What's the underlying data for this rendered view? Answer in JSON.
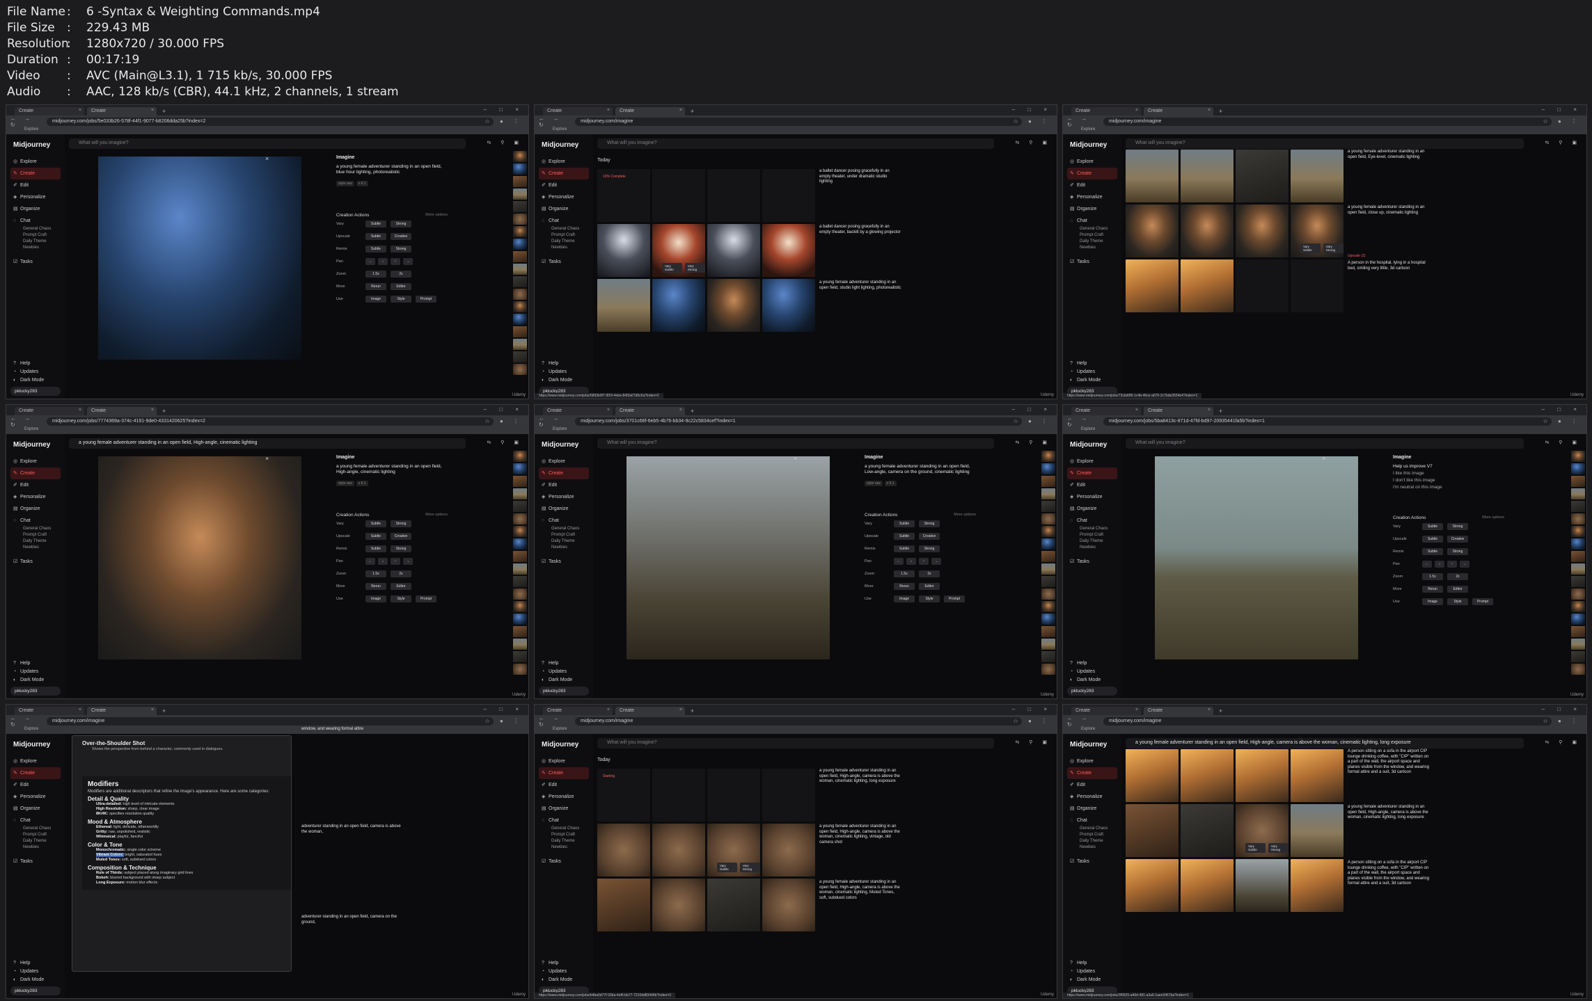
{
  "media_info": [
    {
      "key": "File Name",
      "value": "6 -Syntax & Weighting Commands.mp4"
    },
    {
      "key": "File Size",
      "value": "229.43 MB"
    },
    {
      "key": "Resolution",
      "value": "1280x720 / 30.000 FPS"
    },
    {
      "key": "Duration",
      "value": "00:17:19"
    },
    {
      "key": "Video",
      "value": "AVC (Main@L3.1), 1 715 kb/s, 30.000 FPS"
    },
    {
      "key": "Audio",
      "value": "AAC, 128 kb/s (CBR), 44.1 kHz, 2 channels, 1 stream"
    }
  ],
  "separator": ":",
  "browser": {
    "tab1": "Create",
    "tab2": "Create",
    "tab_close": "×",
    "new_tab": "+",
    "window_controls": "– □ ×",
    "nav_buttons": "← → ↻",
    "addr_icons": "☆ ● ⋮",
    "bookmark": "Explore"
  },
  "sidebar": {
    "logo": "Midjourney",
    "items": [
      {
        "label": "Explore",
        "icon": "◎"
      },
      {
        "label": "Create",
        "icon": "✎"
      },
      {
        "label": "Edit",
        "icon": "✐"
      },
      {
        "label": "Personalize",
        "icon": "◈"
      },
      {
        "label": "Organize",
        "icon": "▤"
      },
      {
        "label": "Chat",
        "icon": "◌"
      }
    ],
    "chat_rooms": [
      "General Chaos",
      "Prompt Craft",
      "Daily Theme",
      "Newbies"
    ],
    "tasks": {
      "label": "Tasks",
      "icon": "☑"
    },
    "bottom": [
      {
        "label": "Help",
        "icon": "?"
      },
      {
        "label": "Updates",
        "icon": "◔"
      },
      {
        "label": "Dark Mode",
        "icon": "◐"
      }
    ],
    "user": "pklucky283"
  },
  "prompt_placeholder": "What will you imagine?",
  "prompt_tools": "⇆ ⚲ ▣",
  "today_label": "Today",
  "watermark": "Udemy",
  "detail": {
    "imagine": "Imagine",
    "creation_actions": "Creation Actions",
    "more_options": "More options",
    "style_raw": "style raw",
    "version": "v 6.1",
    "actions": [
      {
        "label": "Vary",
        "buttons": [
          "Subtle",
          "Strong"
        ]
      },
      {
        "label": "Upscale",
        "buttons": [
          "Subtle",
          "Creative"
        ]
      },
      {
        "label": "Remix",
        "buttons": [
          "Subtle",
          "Strong"
        ]
      },
      {
        "label": "Pan",
        "buttons": [
          "←",
          "↓",
          "↑",
          "→"
        ]
      },
      {
        "label": "Zoom",
        "buttons": [
          "1.5x",
          "2x"
        ]
      },
      {
        "label": "More",
        "buttons": [
          "Rerun",
          "Editor"
        ]
      },
      {
        "label": "Use",
        "buttons": [
          "Image",
          "Style",
          "Prompt"
        ]
      }
    ],
    "feedback_title": "Help us improve V7",
    "feedback_options": [
      "I like this image",
      "I don't like this image",
      "I'm neutral on this image"
    ]
  },
  "vary_tags": [
    "Vary Subtle",
    "Vary Strong"
  ],
  "frames": [
    {
      "url": "midjourney.com/jobs/5e033b26-578f-44f1-9077-b8206dda25b?index=2",
      "view": "detail",
      "prompt": "",
      "desc": "a young female adventurer standing in an open field, blue hour lighting, photorealistic"
    },
    {
      "url": "midjourney.com/imagine",
      "view": "feed",
      "status": "10% Complete",
      "prompts": [
        "a ballet dancer posing gracefully in an empty theater, under dramatic studio lighting",
        "a ballet dancer posing gracefully in an empty theater, backlit by a glowing projector",
        "a young female adventurer standing in an open field, studio light lighting, photorealistic"
      ],
      "statusurl": "https://www.midjourney.com/jobs/5893b0f7-9f24-4ebe-84f3a07d5c6a?index=2"
    },
    {
      "url": "midjourney.com/imagine",
      "view": "feed",
      "prompts": [
        "a young female adventurer standing in an open field, Eye-level, cinematic lighting",
        "a young female adventurer standing in an open field, close up, cinematic lighting",
        "A person in the hospital, lying in a hospital bed, smiling very little, 3d cartoon"
      ],
      "badge": "Upscale (2)",
      "statusurl": "https://www.midjourney.com/jobs/73cbd0f6-1c4b-46ce-a676-2c7bde3554e4?index=1"
    },
    {
      "url": "midjourney.com/jobs/7774369a-374c-4191-9de0-4331420625?index=2",
      "view": "detail",
      "prompt": "a young female adventurer standing in an open field, High-angle, cinematic lighting",
      "desc": "a young female adventurer standing in an open field, High-angle, cinematic lighting",
      "badge": "0/3"
    },
    {
      "url": "midjourney.com/jobs/3701c66f-6eb5-4b76-bb34-9c22c5834cef?index=1",
      "view": "detail",
      "prompt": "",
      "desc": "a young female adventurer standing in an open field, Low-angle, camera on the ground, cinematic lighting"
    },
    {
      "url": "midjourney.com/jobs/5ba8413c-871d-47fd-bd97-20935441fa5b?index=1",
      "view": "detail-feedback",
      "prompt": "",
      "desc": ""
    },
    {
      "url": "midjourney.com/imagine",
      "view": "help",
      "help": {
        "top_heading": "Over-the-Shoulder Shot",
        "top_note": "Shows the perspective from behind a character, commonly used in dialogues.",
        "title": "Modifiers",
        "subtitle": "Modifiers are additional descriptors that refine the image's appearance. Here are some categories:",
        "categories": [
          {
            "name": "Detail & Quality",
            "items": [
              [
                "Ultra-detailed:",
                "high level of intricate elements"
              ],
              [
                "High Resolution:",
                "sharp, clear image"
              ],
              [
                "8K/4K:",
                "specifies resolution quality"
              ]
            ]
          },
          {
            "name": "Mood & Atmosphere",
            "items": [
              [
                "Ethereal:",
                "light, delicate, otherworldly"
              ],
              [
                "Gritty:",
                "raw, unpolished, realistic"
              ],
              [
                "Whimsical:",
                "playful, fanciful"
              ]
            ]
          },
          {
            "name": "Color & Tone",
            "items": [
              [
                "Monochromatic:",
                "single color scheme"
              ],
              [
                "Vibrant Colors:",
                "bright, saturated hues"
              ],
              [
                "Muted Tones:",
                "soft, subdued colors"
              ]
            ]
          },
          {
            "name": "Composition & Technique",
            "items": [
              [
                "Rule of Thirds:",
                "subject placed along imaginary grid lines"
              ],
              [
                "Bokeh:",
                "blurred background with sharp subject"
              ],
              [
                "Long Exposure:",
                "motion blur effects"
              ]
            ]
          }
        ]
      },
      "side_texts": [
        "window, and wearing formal attire",
        "adventurer standing in an open field, camera is above the woman,",
        "adventurer standing in an open field, camera on the ground,",
        "A person sitting on a sofa in the airport CIP lounge, drinking coffee, with \"CIP\" written on a"
      ]
    },
    {
      "url": "midjourney.com/imagine",
      "view": "feed",
      "status": "Starting",
      "prompts": [
        "a young female adventurer standing in an open field, High-angle, camera is above the woman, cinematic lighting, long exposure",
        "a young female adventurer standing in an open field, High-angle, camera is above the woman, cinematic lighting, vintage, old camera shot",
        "a young female adventurer standing in an open field, High-angle, camera is above the woman, cinematic lighting, Muted Tones, soft, subdued colors"
      ],
      "statusurl": "https://www.midjourney.com/jobs/b4ba0d77f-93ba-4ef6-bb77-7210dd83446b?index=3"
    },
    {
      "url": "midjourney.com/imagine",
      "view": "feed",
      "prompt": "a young female adventurer standing in an open field, High-angle, camera is above the woman, cinematic lighting, long exposure",
      "prompts": [
        "A person sitting on a sofa in the airport CIP lounge drinking coffee, with \"CIP\" written on a part of the wall, the airport space and planes visible from the window, and wearing formal attire and a suit, 3d cartoon",
        "a young female adventurer standing in an open field, High-angle, camera is above the woman, cinematic lighting, long exposure",
        "A person sitting on a sofa in the airport CIP lounge drinking coffee, with \"CIP\" written on a part of the wall, the airport space and planes visible from the window, and wearing formal attire and a suit, 3d cartoon"
      ],
      "statusurl": "https://www.midjourney.com/jobs/3f0625-a46d-481-a3a6-1aee3467ba?index=1"
    }
  ]
}
